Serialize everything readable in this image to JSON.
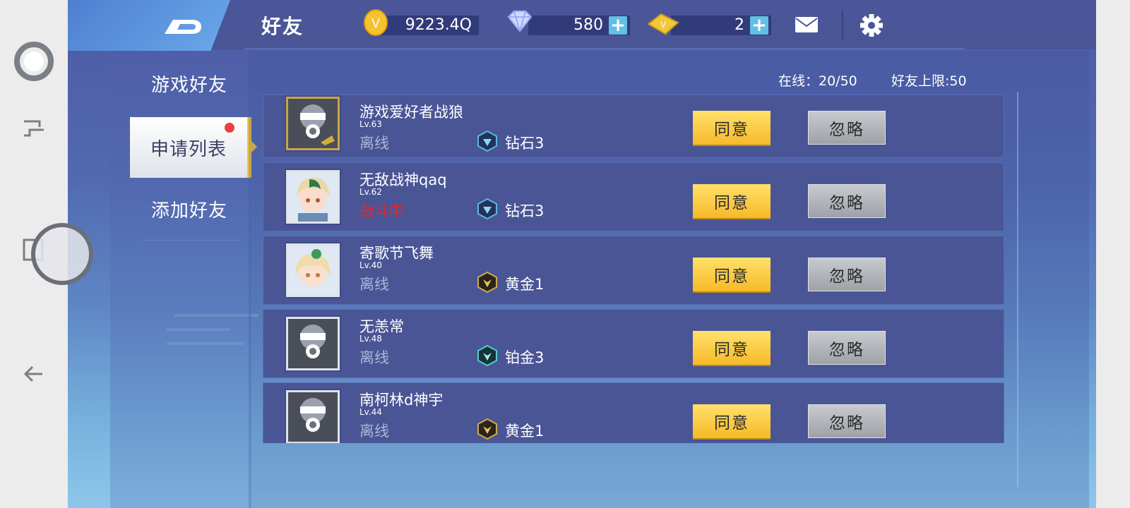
{
  "system_nav": {
    "buttons": [
      "home-circle-icon",
      "multitask-icon",
      "recents-icon",
      "back-arrow-icon"
    ]
  },
  "header": {
    "title": "好友",
    "gold": "9223.4Q",
    "diamonds": "580",
    "tickets": "2",
    "plus": "+",
    "icons": [
      "gold-coin-icon",
      "diamond-icon",
      "ticket-icon",
      "mail-icon",
      "gear-icon"
    ]
  },
  "tabs": {
    "friends": "游戏好友",
    "apply": "申请列表",
    "add": "添加好友"
  },
  "summary": {
    "online": "在线：20/50",
    "limit": "好友上限:50"
  },
  "requests": [
    {
      "name": "游戏爱好者战狼",
      "level": "Lv.63",
      "status": "离线",
      "rank": "钻石3",
      "rank_tier": "diamond",
      "avatar": "gas-mask-gold",
      "agree": "同意",
      "ignore": "忽略"
    },
    {
      "name": "无敌战神qaq",
      "level": "Lv.62",
      "status": "战斗中",
      "rank": "钻石3",
      "rank_tier": "diamond",
      "avatar": "anime-boy",
      "agree": "同意",
      "ignore": "忽略"
    },
    {
      "name": "寄歌节飞舞",
      "level": "Lv.40",
      "status": "离线",
      "rank": "黄金1",
      "rank_tier": "gold",
      "avatar": "anime-girl",
      "agree": "同意",
      "ignore": "忽略"
    },
    {
      "name": "无恙常",
      "level": "Lv.48",
      "status": "离线",
      "rank": "铂金3",
      "rank_tier": "platinum",
      "avatar": "gas-mask",
      "agree": "同意",
      "ignore": "忽略"
    },
    {
      "name": "南柯林d神宇",
      "level": "Lv.44",
      "status": "离线",
      "rank": "黄金1",
      "rank_tier": "gold",
      "avatar": "gas-mask",
      "agree": "同意",
      "ignore": "忽略"
    }
  ],
  "colors": {
    "agree": "#f7b928",
    "ignore": "#9ea2a7",
    "battle": "#e3282a",
    "panel": "#4a5595"
  }
}
